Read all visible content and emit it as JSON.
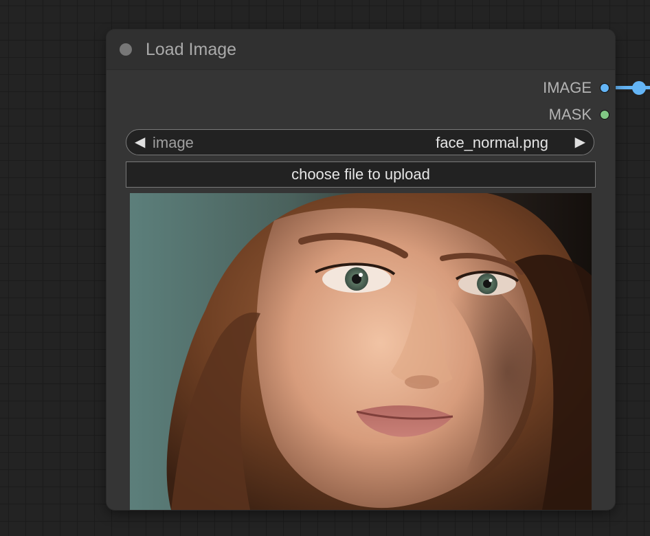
{
  "node": {
    "title": "Load Image",
    "outputs": [
      {
        "label": "IMAGE",
        "color": "#64b5f6"
      },
      {
        "label": "MASK",
        "color": "#81c784"
      }
    ],
    "image_widget": {
      "name": "image",
      "value": "face_normal.png",
      "left_arrow": "◀",
      "right_arrow": "▶"
    },
    "upload_label": "choose file to upload",
    "preview": {
      "description": "close-up portrait photo of a woman with wavy auburn hair and green eyes"
    }
  },
  "colors": {
    "canvas_bg": "#232323",
    "node_bg": "#353535",
    "image_link": "#64b5f6",
    "mask_slot": "#81c784"
  }
}
